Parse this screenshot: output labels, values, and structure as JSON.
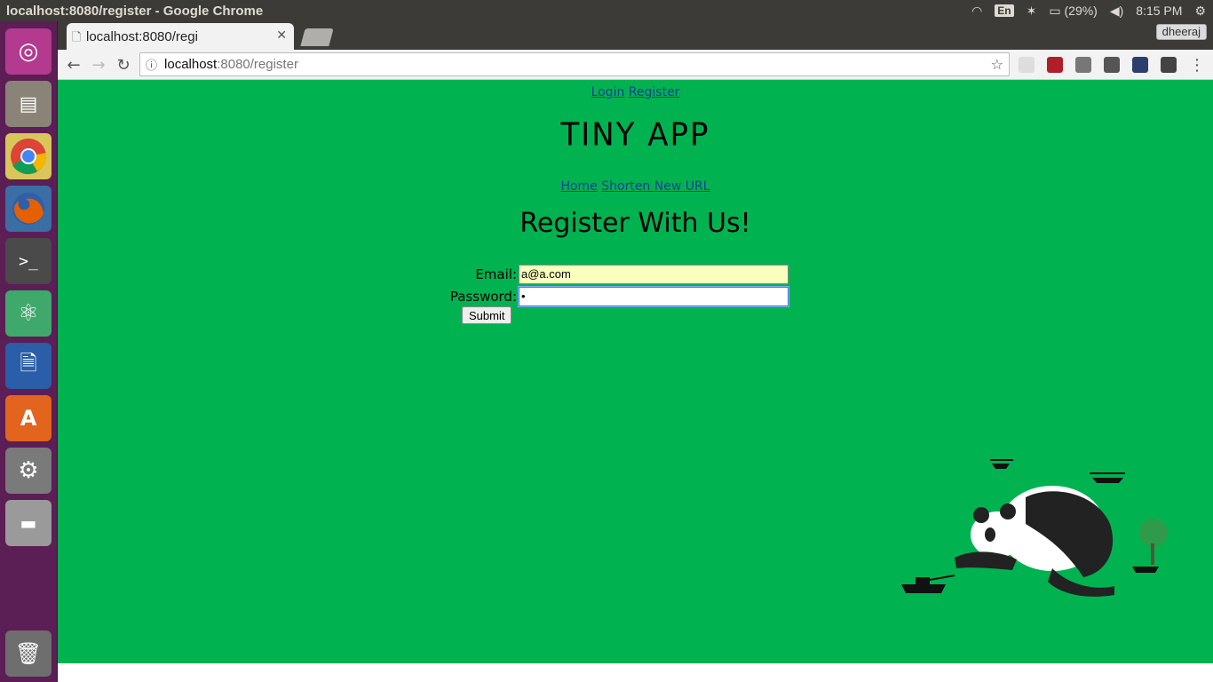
{
  "system": {
    "window_title": "localhost:8080/register - Google Chrome",
    "language": "En",
    "battery": "(29%)",
    "time": "8:15 PM"
  },
  "browser": {
    "tab_title": "localhost:8080/regi",
    "profile": "dheeraj",
    "url_host": "localhost",
    "url_path": ":8080/register"
  },
  "page": {
    "top_links": {
      "login": "Login",
      "register": "Register"
    },
    "app_title": "TINY APP",
    "nav_links": {
      "home": "Home",
      "shorten": "Shorten New URL"
    },
    "heading": "Register With Us!",
    "form": {
      "email_label": "Email:",
      "email_value": "a@a.com",
      "password_label": "Password:",
      "password_value": "•",
      "submit_label": "Submit"
    }
  },
  "colors": {
    "page_background": "#00b350",
    "launcher": "#5b1e55",
    "panel": "#3c3b37"
  },
  "launcher_icons": [
    "ubuntu-dash-icon",
    "files-icon",
    "chrome-icon",
    "firefox-icon",
    "terminal-icon",
    "atom-icon",
    "writer-icon",
    "software-center-icon",
    "system-settings-icon",
    "disk-icon",
    "trash-icon"
  ]
}
